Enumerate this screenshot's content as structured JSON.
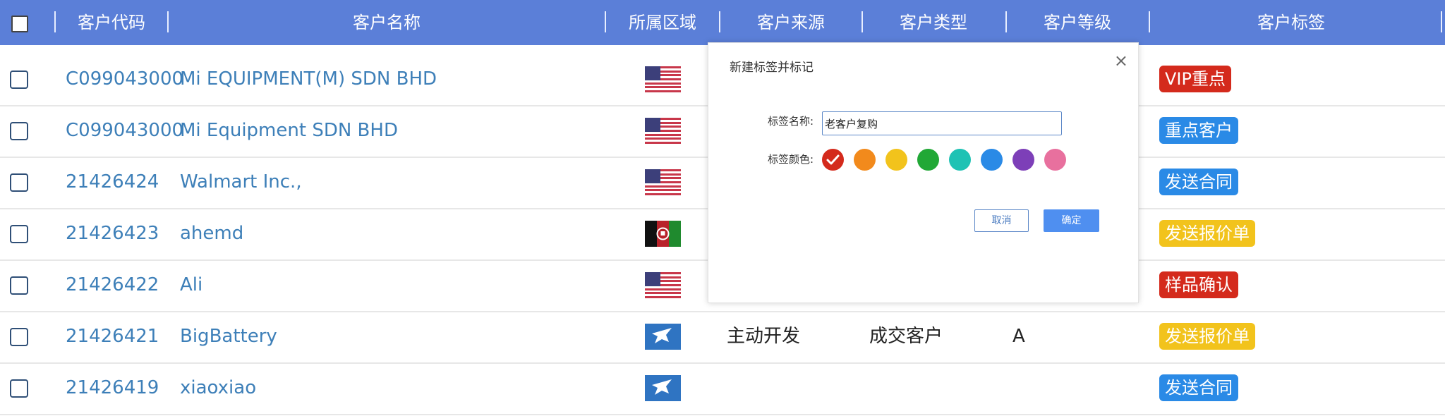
{
  "table": {
    "columns": [
      "客户代码",
      "客户名称",
      "所属区域",
      "客户来源",
      "客户类型",
      "客户等级",
      "客户标签"
    ],
    "rows": [
      {
        "code": "C099043000",
        "name": "Mi EQUIPMENT(M) SDN BHD",
        "region_flag": "us-flag-icon",
        "source": "",
        "type": "",
        "grade": "",
        "tag": "VIP重点",
        "tag_color": "#d42a1c"
      },
      {
        "code": "C099043000",
        "name": "Mi Equipment SDN BHD",
        "region_flag": "us-flag-icon",
        "source": "",
        "type": "",
        "grade": "",
        "tag": "重点客户",
        "tag_color": "#2a8ae6"
      },
      {
        "code": "21426424",
        "name": "Walmart Inc.,",
        "region_flag": "us-flag-icon",
        "source": "",
        "type": "",
        "grade": "",
        "tag": "发送合同",
        "tag_color": "#2a8ae6"
      },
      {
        "code": "21426423",
        "name": "ahemd",
        "region_flag": "afghanistan-flag-icon",
        "source": "",
        "type": "",
        "grade": "",
        "tag": "发送报价单",
        "tag_color": "#f2c31c"
      },
      {
        "code": "21426422",
        "name": "Ali",
        "region_flag": "us-flag-icon",
        "source": "",
        "type": "",
        "grade": "",
        "tag": "样品确认",
        "tag_color": "#d42a1c"
      },
      {
        "code": "21426421",
        "name": "BigBattery",
        "region_flag": "bird-flag-icon",
        "source": "主动开发",
        "type": "成交客户",
        "grade": "A",
        "tag": "发送报价单",
        "tag_color": "#f2c31c"
      },
      {
        "code": "21426419",
        "name": "xiaoxiao",
        "region_flag": "bird-flag-icon",
        "source": "",
        "type": "",
        "grade": "",
        "tag": "发送合同",
        "tag_color": "#2a8ae6"
      }
    ]
  },
  "dialog": {
    "title": "新建标签并标记",
    "close": "×",
    "name_label": "标签名称:",
    "name_value": "老客户复购",
    "color_label": "标签颜色:",
    "colors": [
      "#d42a1c",
      "#f28a1c",
      "#f2c31c",
      "#21a836",
      "#1ec2b4",
      "#2a8ae6",
      "#7d3fb8",
      "#e8709e"
    ],
    "selected_color_index": 0,
    "cancel_label": "取消",
    "ok_label": "确定"
  }
}
